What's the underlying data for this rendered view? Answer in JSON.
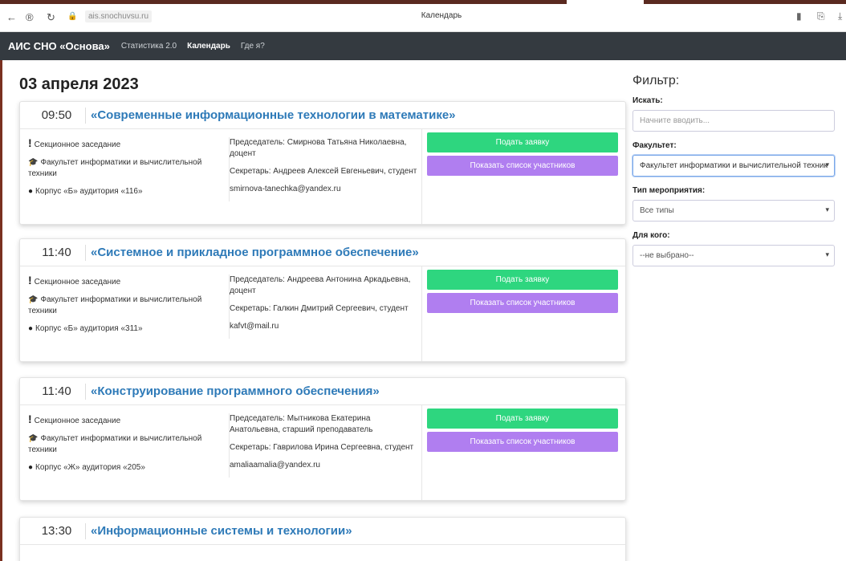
{
  "browser": {
    "url": "ais.snochuvsu.ru",
    "tab_title": "Календарь"
  },
  "navbar": {
    "brand": "АИС СНО «Основа»",
    "links": [
      "Статистика 2.0",
      "Календарь",
      "Где я?"
    ]
  },
  "date_heading": "03 апреля 2023",
  "events": [
    {
      "time": "09:50",
      "title": "«Современные информационные технологии в математике»",
      "type": "Секционное заседание",
      "faculty": "Факультет информатики и вычислительной техники",
      "location": "Корпус «Б» аудитория «116»",
      "chair": "Председатель: Смирнова Татьяна Николаевна, доцент",
      "secretary": "Секретарь: Андреев Алексей Евгеньевич, студент",
      "email": "smirnova-tanechka@yandex.ru",
      "apply_label": "Подать заявку",
      "list_label": "Показать список участников"
    },
    {
      "time": "11:40",
      "title": "«Системное и прикладное программное обеспечение»",
      "type": "Секционное заседание",
      "faculty": "Факультет информатики и вычислительной техники",
      "location": "Корпус «Б» аудитория «311»",
      "chair": "Председатель: Андреева Антонина Аркадьевна, доцент",
      "secretary": "Секретарь: Галкин Дмитрий Сергеевич, студент",
      "email": "kafvt@mail.ru",
      "apply_label": "Подать заявку",
      "list_label": "Показать список участников"
    },
    {
      "time": "11:40",
      "title": "«Конструирование программного обеспечения»",
      "type": "Секционное заседание",
      "faculty": "Факультет информатики и вычислительной техники",
      "location": "Корпус «Ж» аудитория «205»",
      "chair": "Председатель: Мытникова Екатерина Анатольевна, старший преподаватель",
      "secretary": "Секретарь: Гаврилова Ирина Сергеевна, студент",
      "email": "amaliaamalia@yandex.ru",
      "apply_label": "Подать заявку",
      "list_label": "Показать список участников"
    },
    {
      "time": "13:30",
      "title": "«Информационные системы и технологии»"
    }
  ],
  "filter": {
    "title": "Фильтр:",
    "search_label": "Искать:",
    "search_placeholder": "Начните вводить...",
    "faculty_label": "Факультет:",
    "faculty_value": "Факультет информатики и вычислительной техник",
    "type_label": "Тип мероприятия:",
    "type_value": "Все типы",
    "audience_label": "Для кого:",
    "audience_value": "--не выбрано--"
  },
  "colors": {
    "navbar": "#343a40",
    "title_link": "#2e7ab8",
    "apply_button": "#2ed67f",
    "list_button": "#b07ef0"
  }
}
